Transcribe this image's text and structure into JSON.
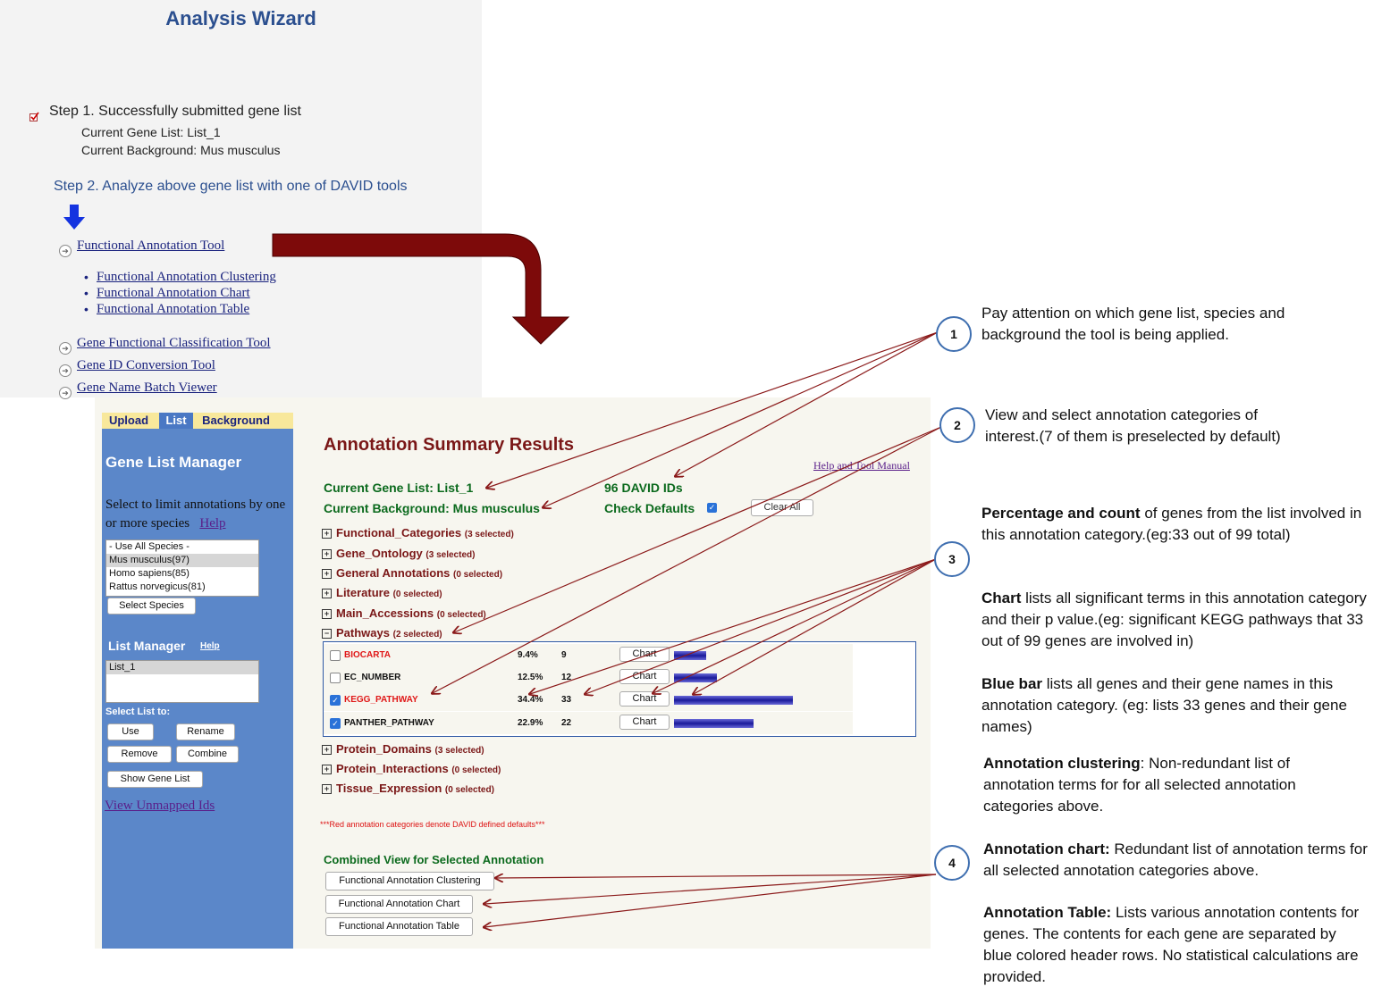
{
  "wizard": {
    "title": "Analysis Wizard",
    "step1": "Step 1. Successfully submitted gene list",
    "current_gene_list": "Current Gene List: List_1",
    "current_background": "Current Background: Mus musculus",
    "step2": "Step 2. Analyze above gene list with one of DAVID tools",
    "tools": [
      "Functional Annotation Tool",
      "Functional Annotation Clustering",
      "Functional Annotation Chart",
      "Functional Annotation Table",
      "Gene Functional Classification Tool",
      "Gene ID Conversion Tool",
      "Gene Name Batch Viewer"
    ]
  },
  "tabs": [
    "Upload",
    "List",
    "Background"
  ],
  "sidebar": {
    "title": "Gene List Manager",
    "select_text": "Select to limit annotations by one or more species",
    "help": "Help",
    "species": [
      "- Use All Species -",
      "Mus musculus(97)",
      "Homo sapiens(85)",
      "Rattus norvegicus(81)"
    ],
    "select_species": "Select Species",
    "list_manager": "List Manager",
    "list_help": "Help",
    "lists": [
      "List_1"
    ],
    "select_list_to": "Select List to:",
    "buttons": {
      "use": "Use",
      "rename": "Rename",
      "remove": "Remove",
      "combine": "Combine",
      "show": "Show Gene List"
    },
    "unmapped": "View Unmapped Ids"
  },
  "summary": {
    "title": "Annotation Summary Results",
    "help_manual": "Help and Tool Manual",
    "current_gene_list": "Current Gene List: List_1",
    "current_background": "Current Background: Mus musculus",
    "david_ids": "96 DAVID IDs",
    "check_defaults": "Check Defaults",
    "clear_all": "Clear All",
    "categories": [
      {
        "name": "Functional_Categories",
        "count": "(3 selected)"
      },
      {
        "name": "Gene_Ontology",
        "count": "(3 selected)"
      },
      {
        "name": "General Annotations",
        "count": "(0 selected)"
      },
      {
        "name": "Literature",
        "count": "(0 selected)"
      },
      {
        "name": "Main_Accessions",
        "count": "(0 selected)"
      },
      {
        "name": "Pathways",
        "count": "(2 selected)"
      }
    ],
    "categories_after": [
      {
        "name": "Protein_Domains",
        "count": "(3 selected)"
      },
      {
        "name": "Protein_Interactions",
        "count": "(0 selected)"
      },
      {
        "name": "Tissue_Expression",
        "count": "(0 selected)"
      }
    ],
    "pathways": [
      {
        "name": "BIOCARTA",
        "percent": "9.4%",
        "count": "9",
        "chart": "Chart",
        "checked": false,
        "color": "#e01818",
        "bar_fraction": 0.27
      },
      {
        "name": "EC_NUMBER",
        "percent": "12.5%",
        "count": "12",
        "chart": "Chart",
        "checked": false,
        "color": "#111111",
        "bar_fraction": 0.36
      },
      {
        "name": "KEGG_PATHWAY",
        "percent": "34.4%",
        "count": "33",
        "chart": "Chart",
        "checked": true,
        "color": "#e01818",
        "bar_fraction": 1.0
      },
      {
        "name": "PANTHER_PATHWAY",
        "percent": "22.9%",
        "count": "22",
        "chart": "Chart",
        "checked": true,
        "color": "#111111",
        "bar_fraction": 0.67
      }
    ],
    "red_note": "***Red annotation categories denote DAVID defined defaults***",
    "combined_title": "Combined View for Selected Annotation",
    "combined_buttons": [
      "Functional Annotation Clustering",
      "Functional Annotation Chart",
      "Functional Annotation Table"
    ]
  },
  "annotations": {
    "n1": "1",
    "n2": "2",
    "n3": "3",
    "n4": "4",
    "note1": "Pay attention on which gene list, species and background the tool is being applied.",
    "note2": "View and select annotation categories of interest.(7 of them is preselected by default)",
    "note3a_bold": "Percentage  and count",
    "note3a": " of genes from the list involved in this annotation category.(eg:33 out of 99 total)",
    "note3b_bold": "Chart",
    "note3b": " lists all significant terms in this annotation category and their p value.(eg: significant KEGG pathways that 33 out of 99 genes are involved in)",
    "note3c_bold": "Blue bar",
    "note3c": " lists all genes and their gene names in this annotation category. (eg: lists 33 genes and their gene names)",
    "note4a_bold": "Annotation clustering",
    "note4a": ": Non-redundant list of annotation terms for for all selected annotation categories above.",
    "note4b_bold": "Annotation chart:",
    "note4b": " Redundant list of annotation terms for all selected annotation categories above.",
    "note4c_bold": "Annotation Table:",
    "note4c": " Lists various annotation contents for genes. The contents for  each gene are separated by blue colored header rows. No statistical calculations are provided."
  }
}
